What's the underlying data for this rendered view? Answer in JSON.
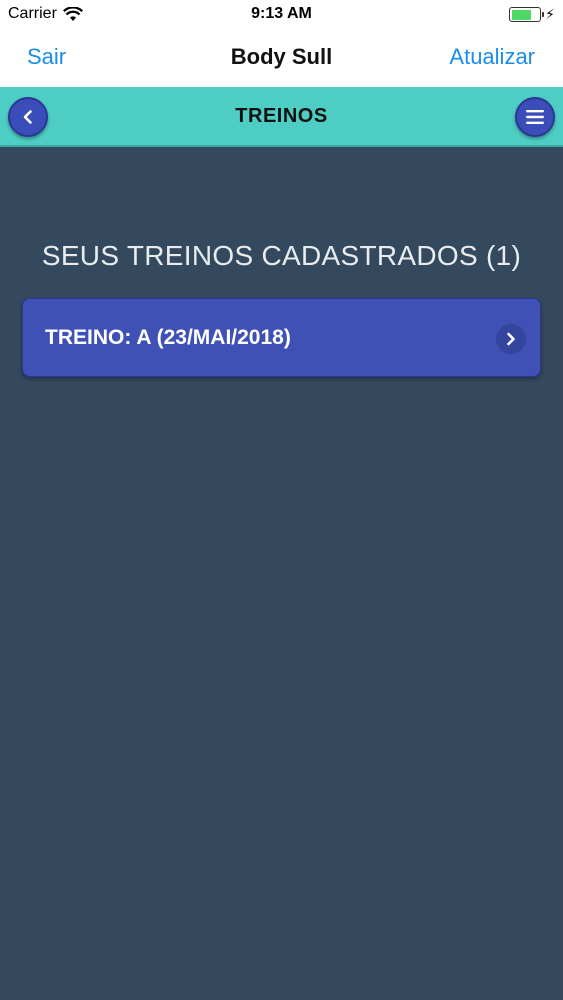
{
  "status_bar": {
    "carrier": "Carrier",
    "time": "9:13 AM",
    "battery_level": 0.7
  },
  "nav_bar": {
    "left_label": "Sair",
    "title": "Body Sull",
    "right_label": "Atualizar"
  },
  "header": {
    "title": "TREINOS",
    "back_icon": "chevron-left-icon",
    "menu_icon": "hamburger-icon"
  },
  "main": {
    "section_title": "SEUS TREINOS CADASTRADOS (1)",
    "items": [
      {
        "label": "TREINO: A (23/MAI/2018)"
      }
    ]
  },
  "colors": {
    "accent": "#4ecdc4",
    "background": "#34495e",
    "card": "#3f51b5",
    "link": "#1a8ee6"
  }
}
